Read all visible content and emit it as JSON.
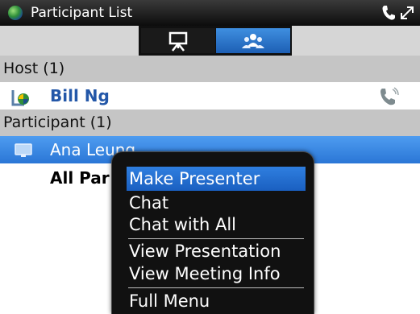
{
  "titlebar": {
    "title": "Participant List"
  },
  "toggle": {
    "presentation_icon": "presentation-board-icon",
    "participants_icon": "participants-icon",
    "active": "participants"
  },
  "host_section": {
    "label": "Host (1)"
  },
  "host": {
    "name": "Bill Ng"
  },
  "participant_section": {
    "label": "Participant (1)"
  },
  "participants": [
    {
      "name": "Ana Leung"
    }
  ],
  "all_participants": {
    "label": "All Par"
  },
  "context_menu": {
    "items": [
      {
        "label": "Make Presenter",
        "selected": true
      },
      {
        "label": "Chat"
      },
      {
        "label": "Chat with All"
      },
      {
        "label": "View Presentation"
      },
      {
        "label": "View Meeting Info"
      },
      {
        "label": "Full Menu"
      }
    ]
  },
  "colors": {
    "selection_blue": "#2a76d6",
    "host_name": "#2357a8",
    "section_gray": "#c5c5c5",
    "menu_bg": "#111111"
  }
}
